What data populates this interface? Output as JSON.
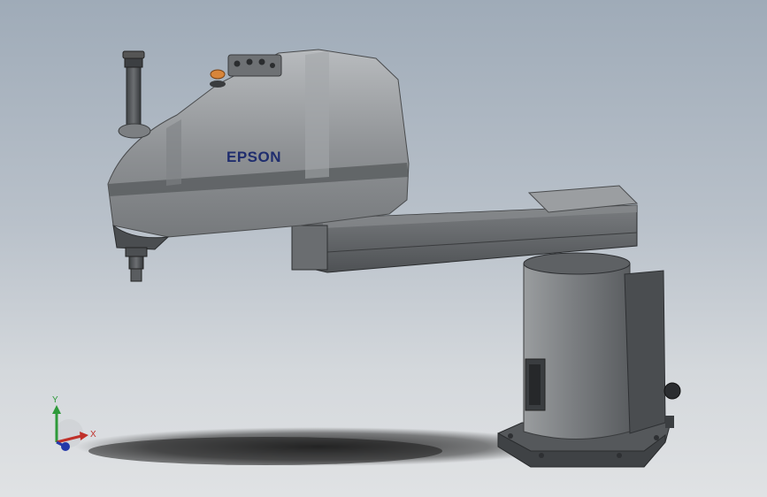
{
  "model": {
    "brand_label": "EPSON",
    "brand_color": "#1f2d6e",
    "body_color": "#8e9194",
    "arm_color": "#5c5f62",
    "base_color": "#6f7275",
    "accent_color": "#d8853a"
  },
  "triad": {
    "x_label": "X",
    "y_label": "Y",
    "x_color": "#c0302a",
    "y_color": "#2e9a3a",
    "z_color": "#2438a8"
  }
}
